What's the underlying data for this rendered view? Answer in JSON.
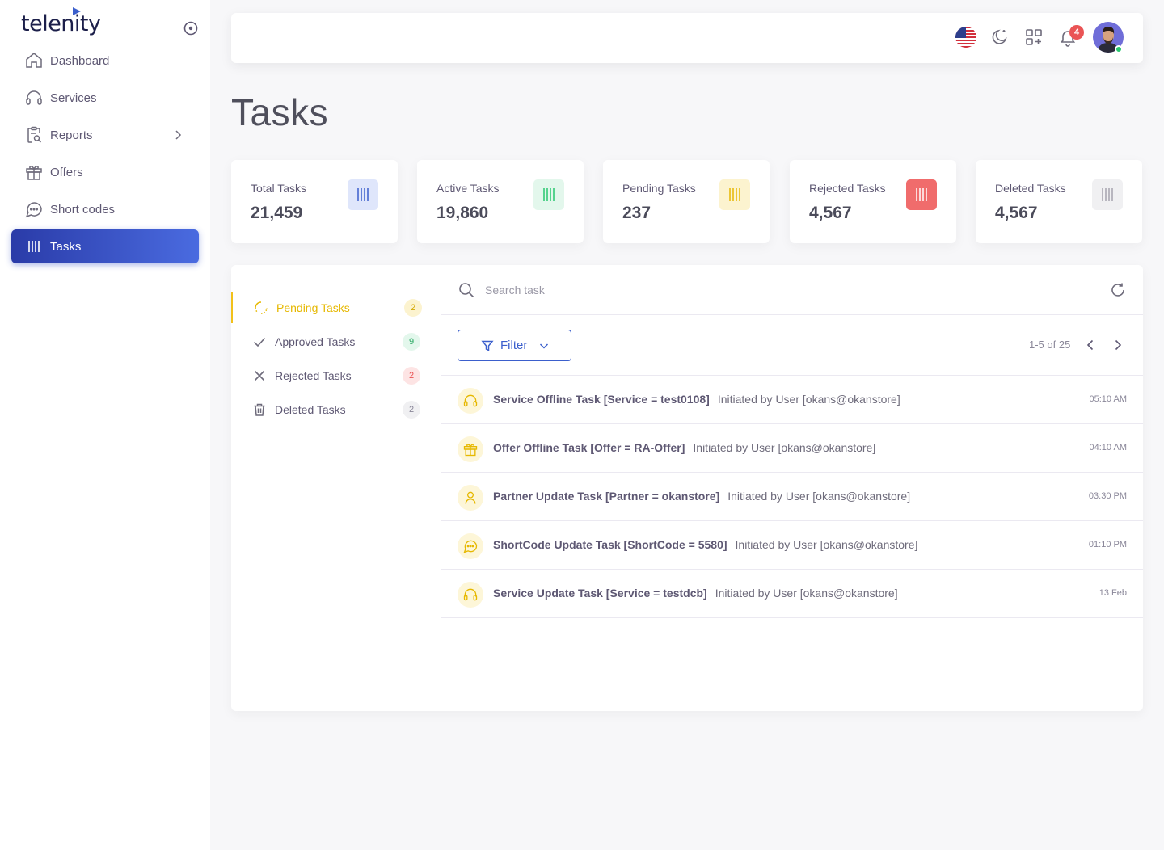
{
  "app": {
    "logo_text": "telenity"
  },
  "sidebar": {
    "items": [
      {
        "label": "Dashboard",
        "icon": "home-icon"
      },
      {
        "label": "Services",
        "icon": "headphones-icon"
      },
      {
        "label": "Reports",
        "icon": "clipboard-search-icon",
        "has_submenu": true
      },
      {
        "label": "Offers",
        "icon": "gift-icon"
      },
      {
        "label": "Short codes",
        "icon": "message-circle-icon"
      },
      {
        "label": "Tasks",
        "icon": "tasks-bars-icon",
        "active": true
      }
    ]
  },
  "topbar": {
    "notification_count": "4",
    "language": "us-flag-icon",
    "icons": [
      "us-flag-icon",
      "dark-mode-icon",
      "apps-grid-icon",
      "bell-icon",
      "avatar"
    ]
  },
  "page": {
    "title": "Tasks"
  },
  "stats": [
    {
      "label": "Total Tasks",
      "value": "21,459",
      "color": "#3b5fcc",
      "bg": "#dfe6fb"
    },
    {
      "label": "Active Tasks",
      "value": "19,860",
      "color": "#28c76f",
      "bg": "#e3f7ec"
    },
    {
      "label": "Pending Tasks",
      "value": "237",
      "color": "#e6b800",
      "bg": "#fcf3cf"
    },
    {
      "label": "Rejected Tasks",
      "value": "4,567",
      "color": "#ffffff",
      "bg": "#f06c6c"
    },
    {
      "label": "Deleted Tasks",
      "value": "4,567",
      "color": "#a5a3ae",
      "bg": "#f0f0f2"
    }
  ],
  "task_filters": [
    {
      "label": "Pending Tasks",
      "count": "2",
      "active": true,
      "count_bg": "#fcf3cf",
      "count_color": "#d4a800"
    },
    {
      "label": "Approved Tasks",
      "count": "9",
      "count_bg": "#e3f7ec",
      "count_color": "#28a862"
    },
    {
      "label": "Rejected Tasks",
      "count": "2",
      "count_bg": "#fde4e4",
      "count_color": "#ea5455"
    },
    {
      "label": "Deleted Tasks",
      "count": "2",
      "count_bg": "#f0f0f2",
      "count_color": "#8a8799"
    }
  ],
  "search": {
    "placeholder": "Search task",
    "value": ""
  },
  "toolbar": {
    "filter_label": "Filter",
    "pagination": "1-5 of 25"
  },
  "tasks": [
    {
      "icon": "headphones-icon",
      "title": "Service Offline Task [Service = test0108]",
      "subtitle": "Initiated by User [okans@okanstore]",
      "time": "05:10 AM"
    },
    {
      "icon": "gift-icon",
      "title": "Offer Offline Task [Offer = RA-Offer]",
      "subtitle": "Initiated by User [okans@okanstore]",
      "time": "04:10 AM"
    },
    {
      "icon": "user-icon",
      "title": "Partner Update Task [Partner = okanstore]",
      "subtitle": "Initiated by User [okans@okanstore]",
      "time": "03:30 PM"
    },
    {
      "icon": "message-circle-icon",
      "title": "ShortCode Update Task [ShortCode = 5580]",
      "subtitle": "Initiated by User [okans@okanstore]",
      "time": "01:10 PM"
    },
    {
      "icon": "headphones-icon",
      "title": "Service Update Task [Service = testdcb]",
      "subtitle": "Initiated by User [okans@okanstore]",
      "time": "13 Feb"
    }
  ]
}
